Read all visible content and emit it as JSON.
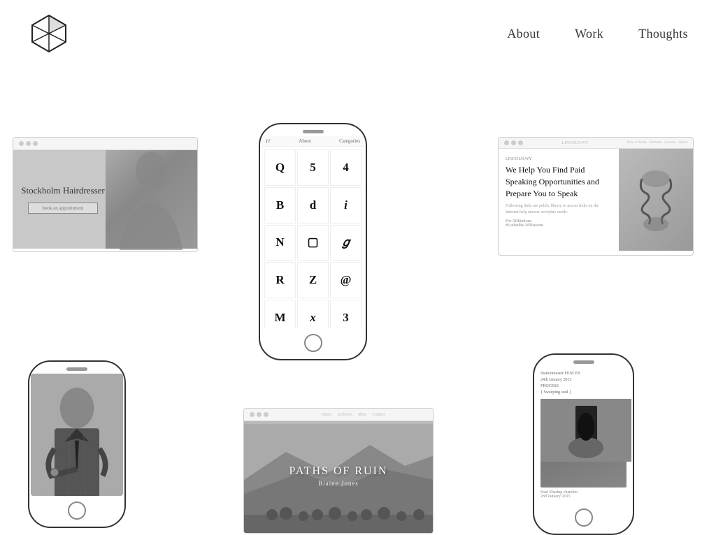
{
  "header": {
    "logo_alt": "Portfolio Logo",
    "nav": {
      "about_label": "About",
      "work_label": "Work",
      "thoughts_label": "Thoughts"
    }
  },
  "cards": {
    "stockholm": {
      "title": "Stockholm Hairdresser",
      "input_placeholder": "book an appointment"
    },
    "font_phone": {
      "nav_brand": "ƒƒ",
      "nav_about": "About",
      "nav_categories": "Categories",
      "cells": [
        "Q",
        "5",
        "4",
        "B",
        "d",
        "i",
        "N",
        "⬜",
        "ℊ",
        "R",
        "Z",
        "@",
        "M",
        "x",
        "3"
      ]
    },
    "speaking": {
      "browser_url": "LINCOLN.WY",
      "subtitle": "We Help You Find Paid Speaking Opportunities and Prepare You to Speak",
      "body": "Following links are public library to access links on the Internet help answer everyday needs.",
      "link1": "For Affiliations",
      "link2": "#LinkedIn/Affiliations"
    },
    "suit_phone": {
      "alt": "Man in suit photo"
    },
    "ruin": {
      "title": "PATHS OF RUIN",
      "subtitle": "Blaine Jones"
    },
    "journal_phone": {
      "line1": "Stationmaster FENCES",
      "line2": "24th January 2015",
      "line3": "PROCESS",
      "line4": "{ Sweeping soul }",
      "footer_label": "Soul Sharing chamber",
      "footer_date": "2nd January 2015"
    }
  }
}
